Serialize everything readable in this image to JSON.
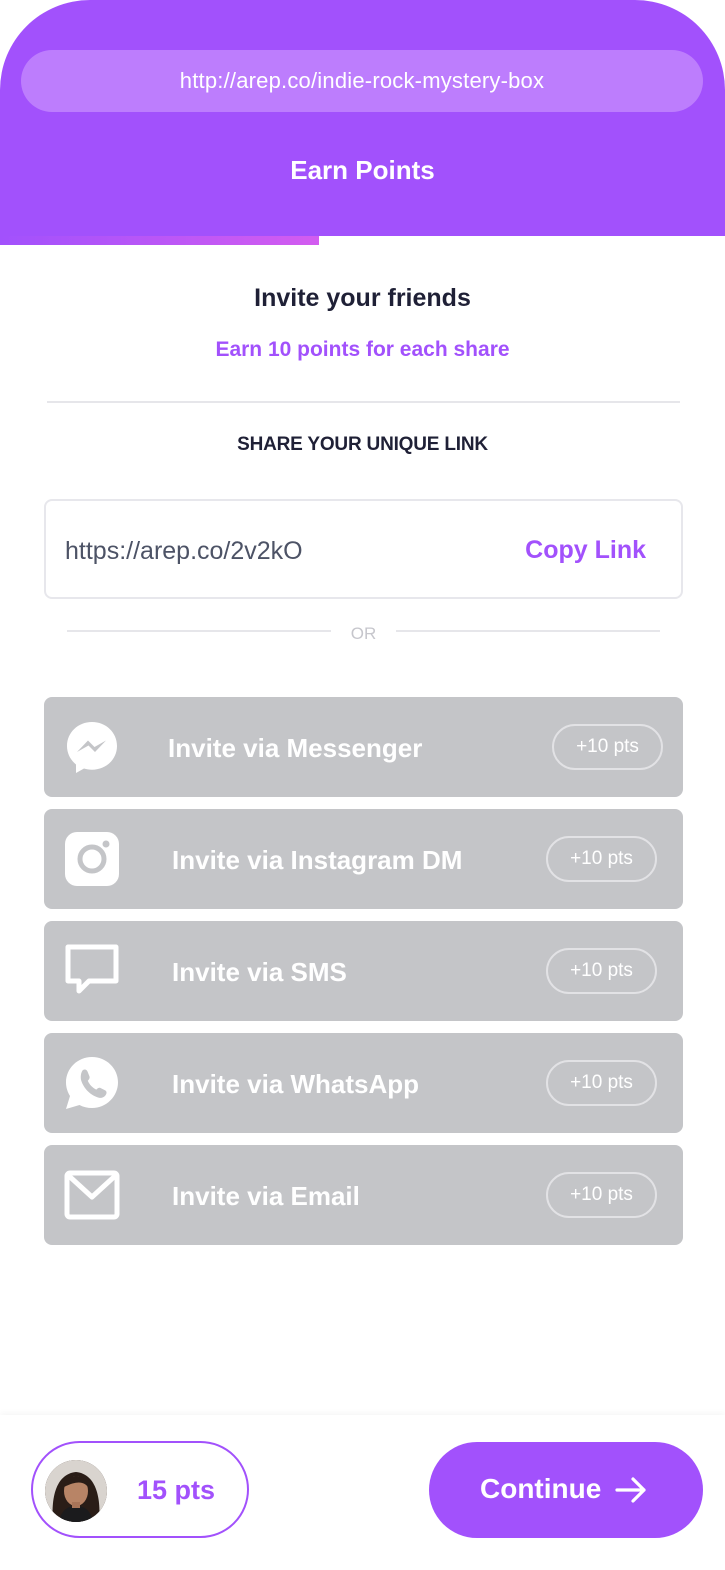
{
  "header": {
    "url": "http://arep.co/indie-rock-mystery-box",
    "title": "Earn Points",
    "progress": 0.44,
    "color": "#a251fc"
  },
  "main": {
    "title": "Invite your friends",
    "subtitle": "Earn 10 points for each share",
    "share_heading": "SHARE YOUR UNIQUE LINK",
    "link": {
      "value": "https://arep.co/2v2kO",
      "copy_label": "Copy Link"
    },
    "or_label": "OR"
  },
  "invites": [
    {
      "label": "Invite via Messenger",
      "points": "+10 pts",
      "icon": "messenger-icon"
    },
    {
      "label": "Invite via Instagram DM",
      "points": "+10 pts",
      "icon": "instagram-icon"
    },
    {
      "label": "Invite via SMS",
      "points": "+10 pts",
      "icon": "sms-icon"
    },
    {
      "label": "Invite via WhatsApp",
      "points": "+10 pts",
      "icon": "whatsapp-icon"
    },
    {
      "label": "Invite via Email",
      "points": "+10 pts",
      "icon": "email-icon"
    }
  ],
  "footer": {
    "points": "15 pts",
    "continue_label": "Continue",
    "accent": "#a251fc"
  }
}
